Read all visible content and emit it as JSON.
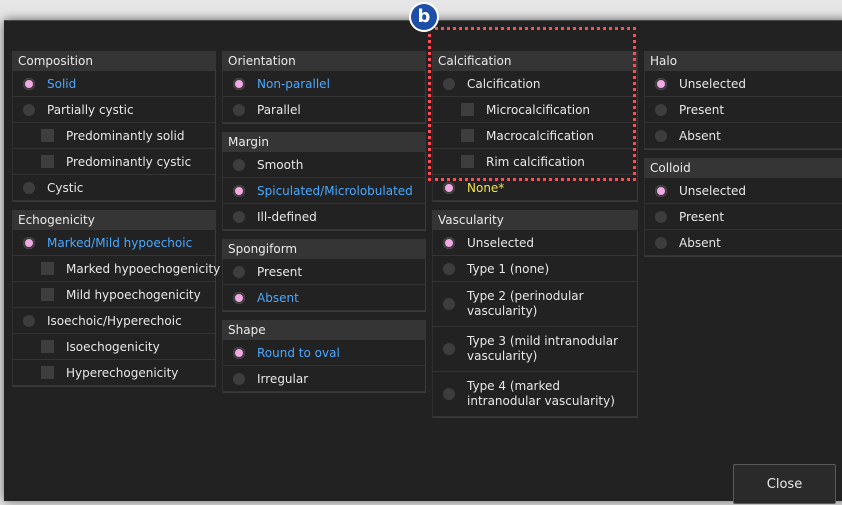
{
  "badge": "b",
  "composition": {
    "title": "Composition",
    "items": [
      {
        "label": "Solid",
        "type": "radio",
        "selected": true
      },
      {
        "label": "Partially cystic",
        "type": "radio",
        "selected": false
      },
      {
        "label": "Predominantly solid",
        "type": "checkbox",
        "selected": false
      },
      {
        "label": "Predominantly cystic",
        "type": "checkbox",
        "selected": false
      },
      {
        "label": "Cystic",
        "type": "radio",
        "selected": false
      }
    ]
  },
  "echogenicity": {
    "title": "Echogenicity",
    "items": [
      {
        "label": "Marked/Mild hypoechoic",
        "type": "radio",
        "selected": true
      },
      {
        "label": "Marked hypoechogenicity",
        "type": "checkbox",
        "selected": false
      },
      {
        "label": "Mild hypoechogenicity",
        "type": "checkbox",
        "selected": false
      },
      {
        "label": "Isoechoic/Hyperechoic",
        "type": "radio",
        "selected": false
      },
      {
        "label": "Isoechogenicity",
        "type": "checkbox",
        "selected": false
      },
      {
        "label": "Hyperechogenicity",
        "type": "checkbox",
        "selected": false
      }
    ]
  },
  "orientation": {
    "title": "Orientation",
    "items": [
      {
        "label": "Non-parallel",
        "selected": true
      },
      {
        "label": "Parallel",
        "selected": false
      }
    ]
  },
  "margin": {
    "title": "Margin",
    "items": [
      {
        "label": "Smooth",
        "selected": false
      },
      {
        "label": "Spiculated/Microlobulated",
        "selected": true
      },
      {
        "label": "Ill-defined",
        "selected": false
      }
    ]
  },
  "spongiform": {
    "title": "Spongiform",
    "items": [
      {
        "label": "Present",
        "selected": false
      },
      {
        "label": "Absent",
        "selected": true
      }
    ]
  },
  "shape": {
    "title": "Shape",
    "items": [
      {
        "label": "Round to oval",
        "selected": true
      },
      {
        "label": "Irregular",
        "selected": false
      }
    ]
  },
  "calcification": {
    "title": "Calcification",
    "items": [
      {
        "label": "Calcification",
        "type": "radio",
        "selected": false
      },
      {
        "label": "Microcalcification",
        "type": "checkbox",
        "selected": false
      },
      {
        "label": "Macrocalcification",
        "type": "checkbox",
        "selected": false
      },
      {
        "label": "Rim calcification",
        "type": "checkbox",
        "selected": false
      },
      {
        "label": "None*",
        "type": "radio",
        "selected": true
      }
    ]
  },
  "vascularity": {
    "title": "Vascularity",
    "items": [
      {
        "label": "Unselected",
        "selected": true
      },
      {
        "label": "Type 1 (none)",
        "selected": false
      },
      {
        "label": "Type 2 (perinodular vascularity)",
        "selected": false
      },
      {
        "label": "Type 3 (mild intranodular vascularity)",
        "selected": false
      },
      {
        "label": "Type 4 (marked intranodular vascularity)",
        "selected": false
      }
    ]
  },
  "halo": {
    "title": "Halo",
    "items": [
      {
        "label": "Unselected",
        "selected": true
      },
      {
        "label": "Present",
        "selected": false
      },
      {
        "label": "Absent",
        "selected": false
      }
    ]
  },
  "colloid": {
    "title": "Colloid",
    "items": [
      {
        "label": "Unselected",
        "selected": true
      },
      {
        "label": "Present",
        "selected": false
      },
      {
        "label": "Absent",
        "selected": false
      }
    ]
  },
  "close_label": "Close",
  "colors": {
    "selected_radio": "#f2a9e3",
    "selected_text": "#4aa8ff",
    "highlight_text": "#f2e24a",
    "highlight_border": "#ff4d57"
  }
}
